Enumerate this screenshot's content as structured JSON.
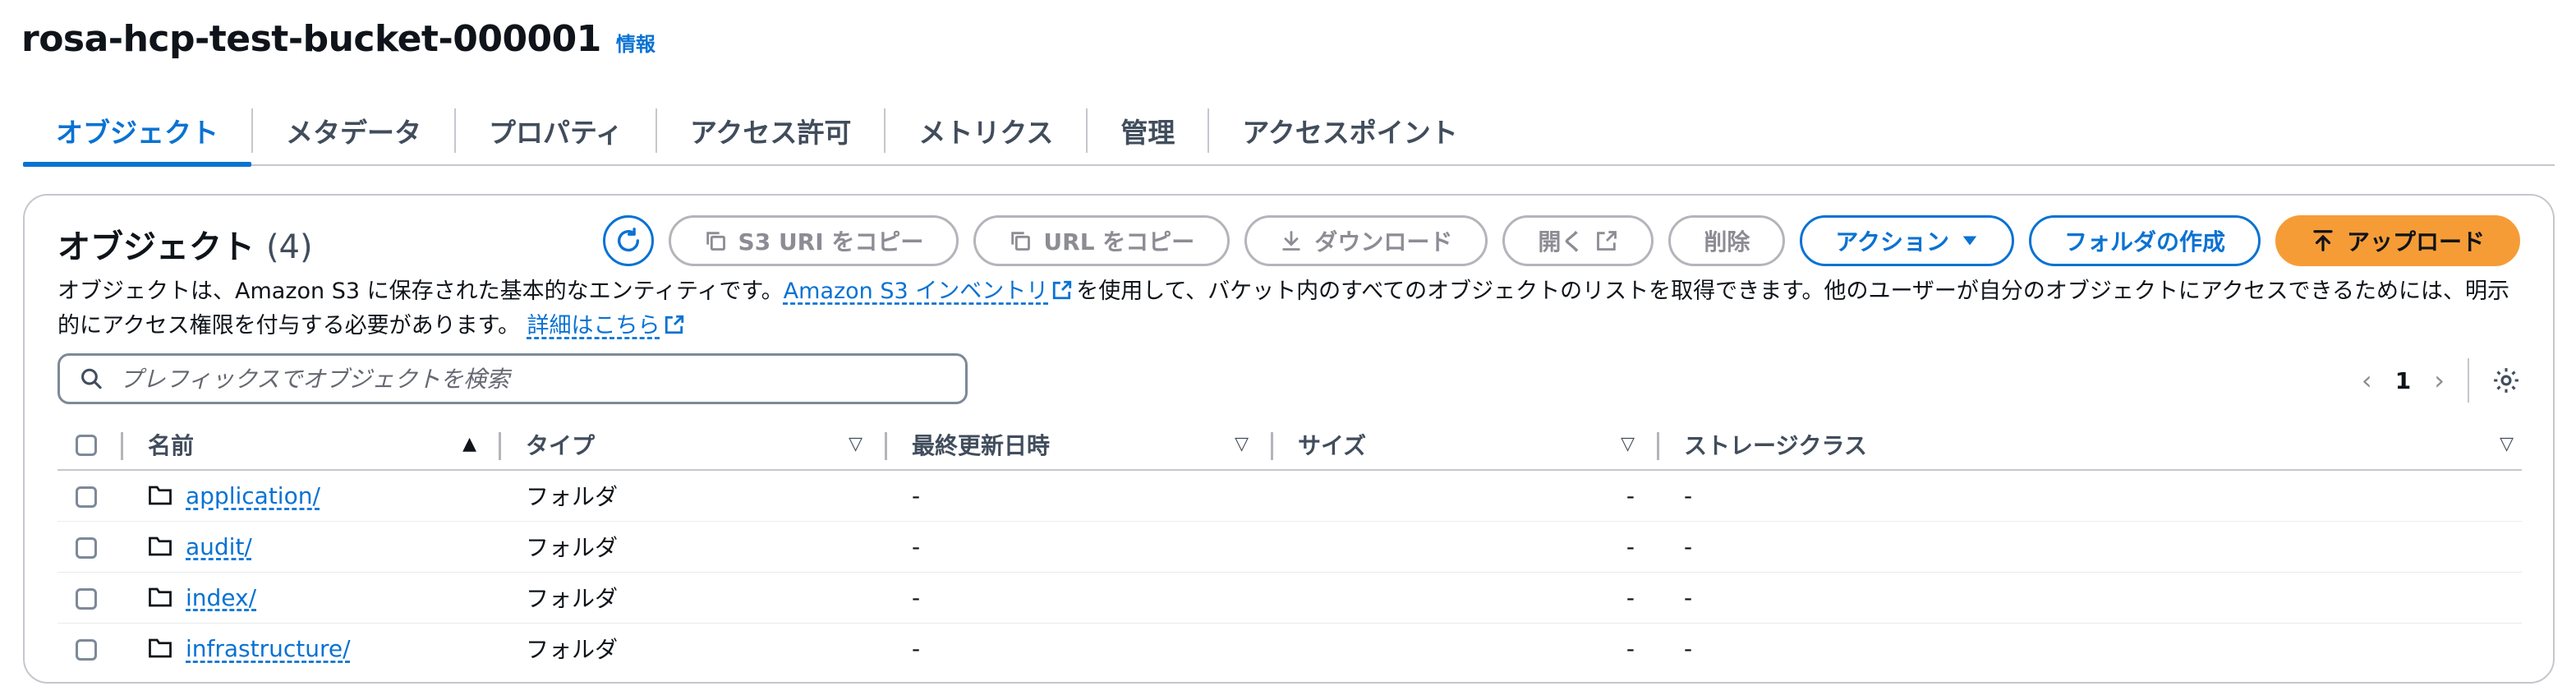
{
  "header": {
    "bucket_name": "rosa-hcp-test-bucket-000001",
    "info_label": "情報"
  },
  "tabs": [
    {
      "label": "オブジェクト",
      "active": true
    },
    {
      "label": "メタデータ",
      "active": false
    },
    {
      "label": "プロパティ",
      "active": false
    },
    {
      "label": "アクセス許可",
      "active": false
    },
    {
      "label": "メトリクス",
      "active": false
    },
    {
      "label": "管理",
      "active": false
    },
    {
      "label": "アクセスポイント",
      "active": false
    }
  ],
  "panel": {
    "title": "オブジェクト",
    "count": "(4)",
    "description_before_link1": "オブジェクトは、Amazon S3 に保存された基本的なエンティティです。",
    "link1": "Amazon S3 インベントリ",
    "description_between": "を使用して、バケット内のすべてのオブジェクトのリストを取得できます。他のユーザーが自分のオブジェクトにアクセスできるためには、明示的にアクセス権限を付与する必要があります。",
    "link2": "詳細はこちら"
  },
  "toolbar": {
    "refresh_icon": "refresh-icon",
    "copy_s3_uri": "S3 URI をコピー",
    "copy_url": "URL をコピー",
    "download": "ダウンロード",
    "open": "開く",
    "delete": "削除",
    "actions": "アクション",
    "create_folder": "フォルダの作成",
    "upload": "アップロード"
  },
  "search": {
    "placeholder": "プレフィックスでオブジェクトを検索",
    "value": ""
  },
  "pagination": {
    "current_page": "1"
  },
  "table": {
    "columns": {
      "name": "名前",
      "type": "タイプ",
      "last_modified": "最終更新日時",
      "size": "サイズ",
      "storage_class": "ストレージクラス"
    },
    "rows": [
      {
        "name": "application/",
        "type": "フォルダ",
        "last_modified": "-",
        "size": "-",
        "storage_class": "-"
      },
      {
        "name": "audit/",
        "type": "フォルダ",
        "last_modified": "-",
        "size": "-",
        "storage_class": "-"
      },
      {
        "name": "index/",
        "type": "フォルダ",
        "last_modified": "-",
        "size": "-",
        "storage_class": "-"
      },
      {
        "name": "infrastructure/",
        "type": "フォルダ",
        "last_modified": "-",
        "size": "-",
        "storage_class": "-"
      }
    ]
  },
  "colors": {
    "accent": "#0972d3",
    "primary_button": "#f69c37",
    "text": "#0f141a",
    "border": "#c6c6cd"
  }
}
